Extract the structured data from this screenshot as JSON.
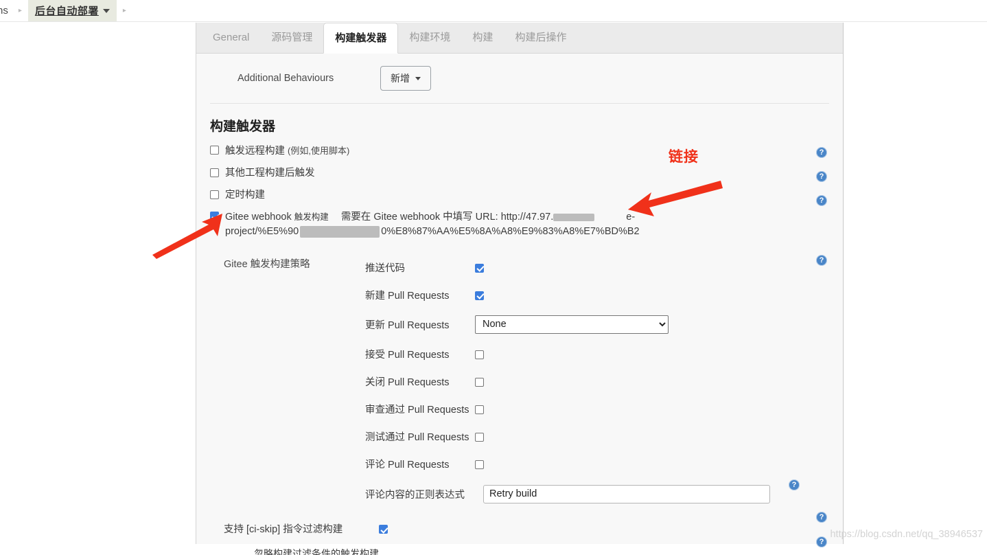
{
  "breadcrumb": {
    "clipped_item": "ns",
    "separator": "▸",
    "active_item": "后台自动部署"
  },
  "tabs": [
    {
      "label": "General",
      "active": false
    },
    {
      "label": "源码管理",
      "active": false
    },
    {
      "label": "构建触发器",
      "active": true
    },
    {
      "label": "构建环境",
      "active": false
    },
    {
      "label": "构建",
      "active": false
    },
    {
      "label": "构建后操作",
      "active": false
    }
  ],
  "behaviours": {
    "label": "Additional Behaviours",
    "add_button": "新增"
  },
  "section": {
    "title": "构建触发器"
  },
  "triggers": [
    {
      "label": "触发远程构建 ",
      "sub": "(例如,使用脚本)",
      "checked": false
    },
    {
      "label": "其他工程构建后触发",
      "sub": "",
      "checked": false
    },
    {
      "label": "定时构建",
      "sub": "",
      "checked": false
    }
  ],
  "webhook": {
    "checked": true,
    "title": "Gitee webhook ",
    "title_small": "触发构建",
    "desc_prefix": "需要在 Gitee webhook 中填写 URL: http://47.97.",
    "desc_tail": "e-",
    "url_line2_prefix": "project/%E5%90",
    "url_line2_suffix": "0%E8%87%AA%E5%8A%A8%E9%83%A8%E7%BD%B2"
  },
  "strategy": {
    "label": "Gitee 触发构建策略",
    "fields": [
      {
        "label": "推送代码",
        "type": "checkbox",
        "checked": true
      },
      {
        "label": "新建 Pull Requests",
        "type": "checkbox",
        "checked": true
      },
      {
        "label": "更新 Pull Requests",
        "type": "select",
        "value": "None",
        "options": [
          "None"
        ]
      },
      {
        "label": "接受 Pull Requests",
        "type": "checkbox",
        "checked": false
      },
      {
        "label": "关闭 Pull Requests",
        "type": "checkbox",
        "checked": false
      },
      {
        "label": "审查通过 Pull Requests",
        "type": "checkbox",
        "checked": false
      },
      {
        "label": "测试通过 Pull Requests",
        "type": "checkbox",
        "checked": false
      },
      {
        "label": "评论 Pull Requests",
        "type": "checkbox",
        "checked": false
      },
      {
        "label": "评论内容的正则表达式",
        "type": "text",
        "value": "Retry build",
        "placeholder": ""
      }
    ]
  },
  "ciskip": {
    "label": "支持 [ci-skip] 指令过滤构建",
    "checked": true,
    "clipped_next_row": "忽略构建过滤条件的触发构建"
  },
  "help_icon_glyph": "?",
  "annotations": {
    "link_text": "链接",
    "arrow_color": "#f0311a"
  },
  "watermark": "https://blog.csdn.net/qq_38946537",
  "colors": {
    "accent_checkbox": "#3b7ddd",
    "help_icon": "#4a86c8",
    "annotation_red": "#f0311a",
    "panel_bg": "#f8f8f8",
    "tabstrip_bg": "#ebebeb",
    "breadcrumb_active_bg": "#e8eae0"
  }
}
